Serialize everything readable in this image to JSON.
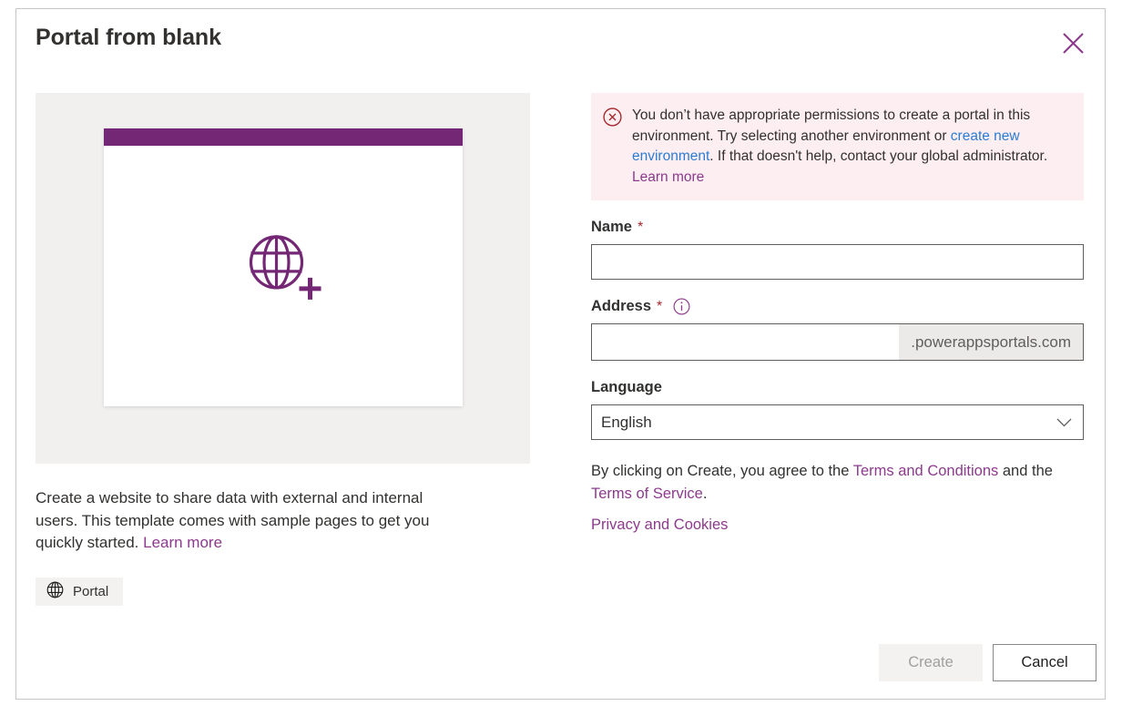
{
  "dialog": {
    "title": "Portal from blank",
    "close_icon": "close-icon"
  },
  "preview": {
    "icon": "globe-plus-icon",
    "accent_color": "#742774"
  },
  "template": {
    "description_part1": "Create a website to share data with external and internal users. This template comes with sample pages to get you quickly started. ",
    "learn_more": "Learn more",
    "tag_label": "Portal",
    "tag_icon": "globe-icon"
  },
  "error": {
    "icon": "error-circle-icon",
    "text_part1": "You don’t have appropriate permissions to create a portal in this environment. Try selecting another environment or ",
    "link_create_env": "create new environment",
    "text_part2": ". If that doesn't help, contact your global administrator. ",
    "learn_more": "Learn more",
    "background_color": "#fdeef1",
    "icon_color": "#a4262c"
  },
  "form": {
    "name": {
      "label": "Name",
      "required_marker": "*",
      "value": "",
      "placeholder": ""
    },
    "address": {
      "label": "Address",
      "required_marker": "*",
      "info_icon": "info-circle-icon",
      "value": "",
      "placeholder": "",
      "suffix": ".powerappsportals.com"
    },
    "language": {
      "label": "Language",
      "selected": "English",
      "chevron_icon": "chevron-down-icon"
    }
  },
  "terms": {
    "prefix": "By clicking on Create, you agree to the ",
    "terms_and_conditions": "Terms and Conditions",
    "middle": " and the ",
    "terms_of_service": "Terms of Service",
    "suffix": ".",
    "privacy_and_cookies": "Privacy and Cookies"
  },
  "footer": {
    "create_label": "Create",
    "cancel_label": "Cancel"
  },
  "colors": {
    "purple_link": "#8c3a8c",
    "blue_link": "#2b7cd3",
    "required_red": "#a4262c"
  }
}
